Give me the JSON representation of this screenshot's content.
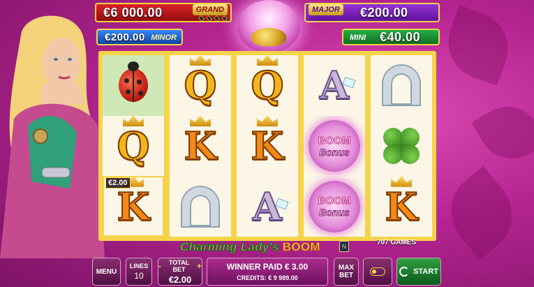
{
  "jackpots": {
    "grand": {
      "label": "GRAND",
      "value": "€6 000.00"
    },
    "major": {
      "label": "MAJOR",
      "value": "€200.00"
    },
    "minor": {
      "label": "MINOR",
      "value": "€200.00"
    },
    "mini": {
      "label": "MINI",
      "value": "€40.00"
    }
  },
  "reels": [
    [
      {
        "symbol": "ladybug"
      },
      {
        "symbol": "Q"
      },
      {
        "symbol": "K",
        "win": "€2.00"
      }
    ],
    [
      {
        "symbol": "Q"
      },
      {
        "symbol": "K"
      },
      {
        "symbol": "horseshoe"
      }
    ],
    [
      {
        "symbol": "Q"
      },
      {
        "symbol": "K"
      },
      {
        "symbol": "A"
      }
    ],
    [
      {
        "symbol": "A"
      },
      {
        "symbol": "boom-bonus"
      },
      {
        "symbol": "boom-bonus"
      }
    ],
    [
      {
        "symbol": "horseshoe"
      },
      {
        "symbol": "clover"
      },
      {
        "symbol": "K"
      }
    ]
  ],
  "symbols": {
    "boom_top": "BOOM",
    "boom_bottom": "Bonus",
    "win_label": "€2.00"
  },
  "logo": {
    "text": "Charming Lady's",
    "boom": "BOOM",
    "studio": "707 GAMES"
  },
  "controls": {
    "menu": "MENU",
    "lines_label": "LINES",
    "lines_value": "10",
    "total_bet_label": "TOTAL BET",
    "total_bet_value": "€2.00",
    "minus": "-",
    "plus": "+",
    "winner_paid": "WINNER PAID € 3.00",
    "credits": "CREDITS: € 9 989.00",
    "max_bet": "MAX BET",
    "start": "START"
  },
  "colors": {
    "frame": "#f5d34a",
    "background": "#b52491",
    "grand": "#e0252a",
    "major": "#9d35e0",
    "minor": "#1a5fd0",
    "mini": "#28b34a"
  }
}
